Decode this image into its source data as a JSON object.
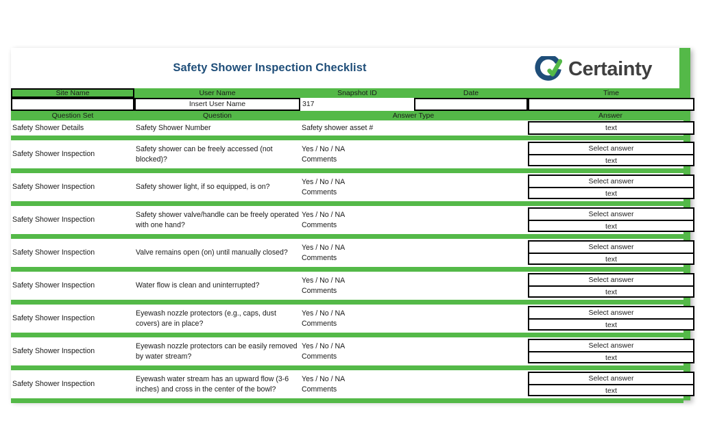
{
  "document": {
    "title": "Safety Shower Inspection Checklist",
    "title_color": "#1f4e79",
    "accent_green": "#54b948",
    "logo": {
      "name": "certainty-logo",
      "wordmark": "Certainty",
      "mark_ring_color": "#1f4e79",
      "mark_check_color": "#54b948",
      "wordmark_color": "#3f3f3f"
    }
  },
  "meta": {
    "headers": [
      {
        "label": "Site Name",
        "boxed": true
      },
      {
        "label": "User Name",
        "boxed": false
      },
      {
        "label": "Snapshot ID",
        "boxed": false
      },
      {
        "label": "Date",
        "boxed": false
      },
      {
        "label": "Time",
        "boxed": false
      }
    ],
    "values": [
      {
        "name": "site-name-input",
        "value": "",
        "placeholder": "",
        "style": "boxed",
        "align": "center"
      },
      {
        "name": "user-name-input",
        "value": "Insert User Name",
        "placeholder": "Insert User Name",
        "style": "boxed",
        "align": "center"
      },
      {
        "name": "snapshot-id-input",
        "value": "317",
        "placeholder": "",
        "style": "plain",
        "align": "left"
      },
      {
        "name": "date-input",
        "value": "",
        "placeholder": "",
        "style": "boxed",
        "align": "center"
      },
      {
        "name": "time-input",
        "value": "",
        "placeholder": "",
        "style": "boxed",
        "align": "center"
      }
    ]
  },
  "table": {
    "columns": [
      "Question Set",
      "Question",
      "Answer Type",
      "Answer"
    ],
    "rows": [
      {
        "question_set": "Safety Shower Details",
        "question": "Safety Shower Number",
        "answer_type": [
          "Safety shower asset #"
        ],
        "answer_fields": [
          {
            "name": "answer-text-input",
            "value": "text"
          }
        ]
      },
      {
        "question_set": "Safety Shower Inspection",
        "question": "Safety shower can be freely accessed (not blocked)?",
        "answer_type": [
          "Yes / No / NA",
          "Comments"
        ],
        "answer_fields": [
          {
            "name": "answer-select",
            "value": "Select answer"
          },
          {
            "name": "answer-comments-input",
            "value": "text"
          }
        ]
      },
      {
        "question_set": "Safety Shower Inspection",
        "question": "Safety shower light, if so equipped, is on?",
        "answer_type": [
          "Yes / No / NA",
          "Comments"
        ],
        "answer_fields": [
          {
            "name": "answer-select",
            "value": "Select answer"
          },
          {
            "name": "answer-comments-input",
            "value": "text"
          }
        ]
      },
      {
        "question_set": "Safety Shower Inspection",
        "question": "Safety shower valve/handle can be freely operated with one hand?",
        "answer_type": [
          "Yes / No / NA",
          "Comments"
        ],
        "answer_fields": [
          {
            "name": "answer-select",
            "value": "Select answer"
          },
          {
            "name": "answer-comments-input",
            "value": "text"
          }
        ]
      },
      {
        "question_set": "Safety Shower Inspection",
        "question": "Valve remains open (on) until manually closed?",
        "answer_type": [
          "Yes / No / NA",
          "Comments"
        ],
        "answer_fields": [
          {
            "name": "answer-select",
            "value": "Select answer"
          },
          {
            "name": "answer-comments-input",
            "value": "text"
          }
        ]
      },
      {
        "question_set": "Safety Shower Inspection",
        "question": "Water flow is clean and uninterrupted?",
        "answer_type": [
          "Yes / No / NA",
          "Comments"
        ],
        "answer_fields": [
          {
            "name": "answer-select",
            "value": "Select answer"
          },
          {
            "name": "answer-comments-input",
            "value": "text"
          }
        ]
      },
      {
        "question_set": "Safety Shower Inspection",
        "question": "Eyewash nozzle protectors (e.g., caps, dust covers) are in place?",
        "answer_type": [
          "Yes / No / NA",
          "Comments"
        ],
        "answer_fields": [
          {
            "name": "answer-select",
            "value": "Select answer"
          },
          {
            "name": "answer-comments-input",
            "value": "text"
          }
        ]
      },
      {
        "question_set": "Safety Shower Inspection",
        "question": "Eyewash nozzle protectors can be easily removed by water stream?",
        "answer_type": [
          "Yes / No / NA",
          "Comments"
        ],
        "answer_fields": [
          {
            "name": "answer-select",
            "value": "Select answer"
          },
          {
            "name": "answer-comments-input",
            "value": "text"
          }
        ]
      },
      {
        "question_set": "Safety Shower Inspection",
        "question": "Eyewash water stream has an upward flow (3-6 inches) and cross in the center of the bowl?",
        "answer_type": [
          "Yes / No / NA",
          "Comments"
        ],
        "answer_fields": [
          {
            "name": "answer-select",
            "value": "Select answer"
          },
          {
            "name": "answer-comments-input",
            "value": "text"
          }
        ]
      }
    ]
  }
}
